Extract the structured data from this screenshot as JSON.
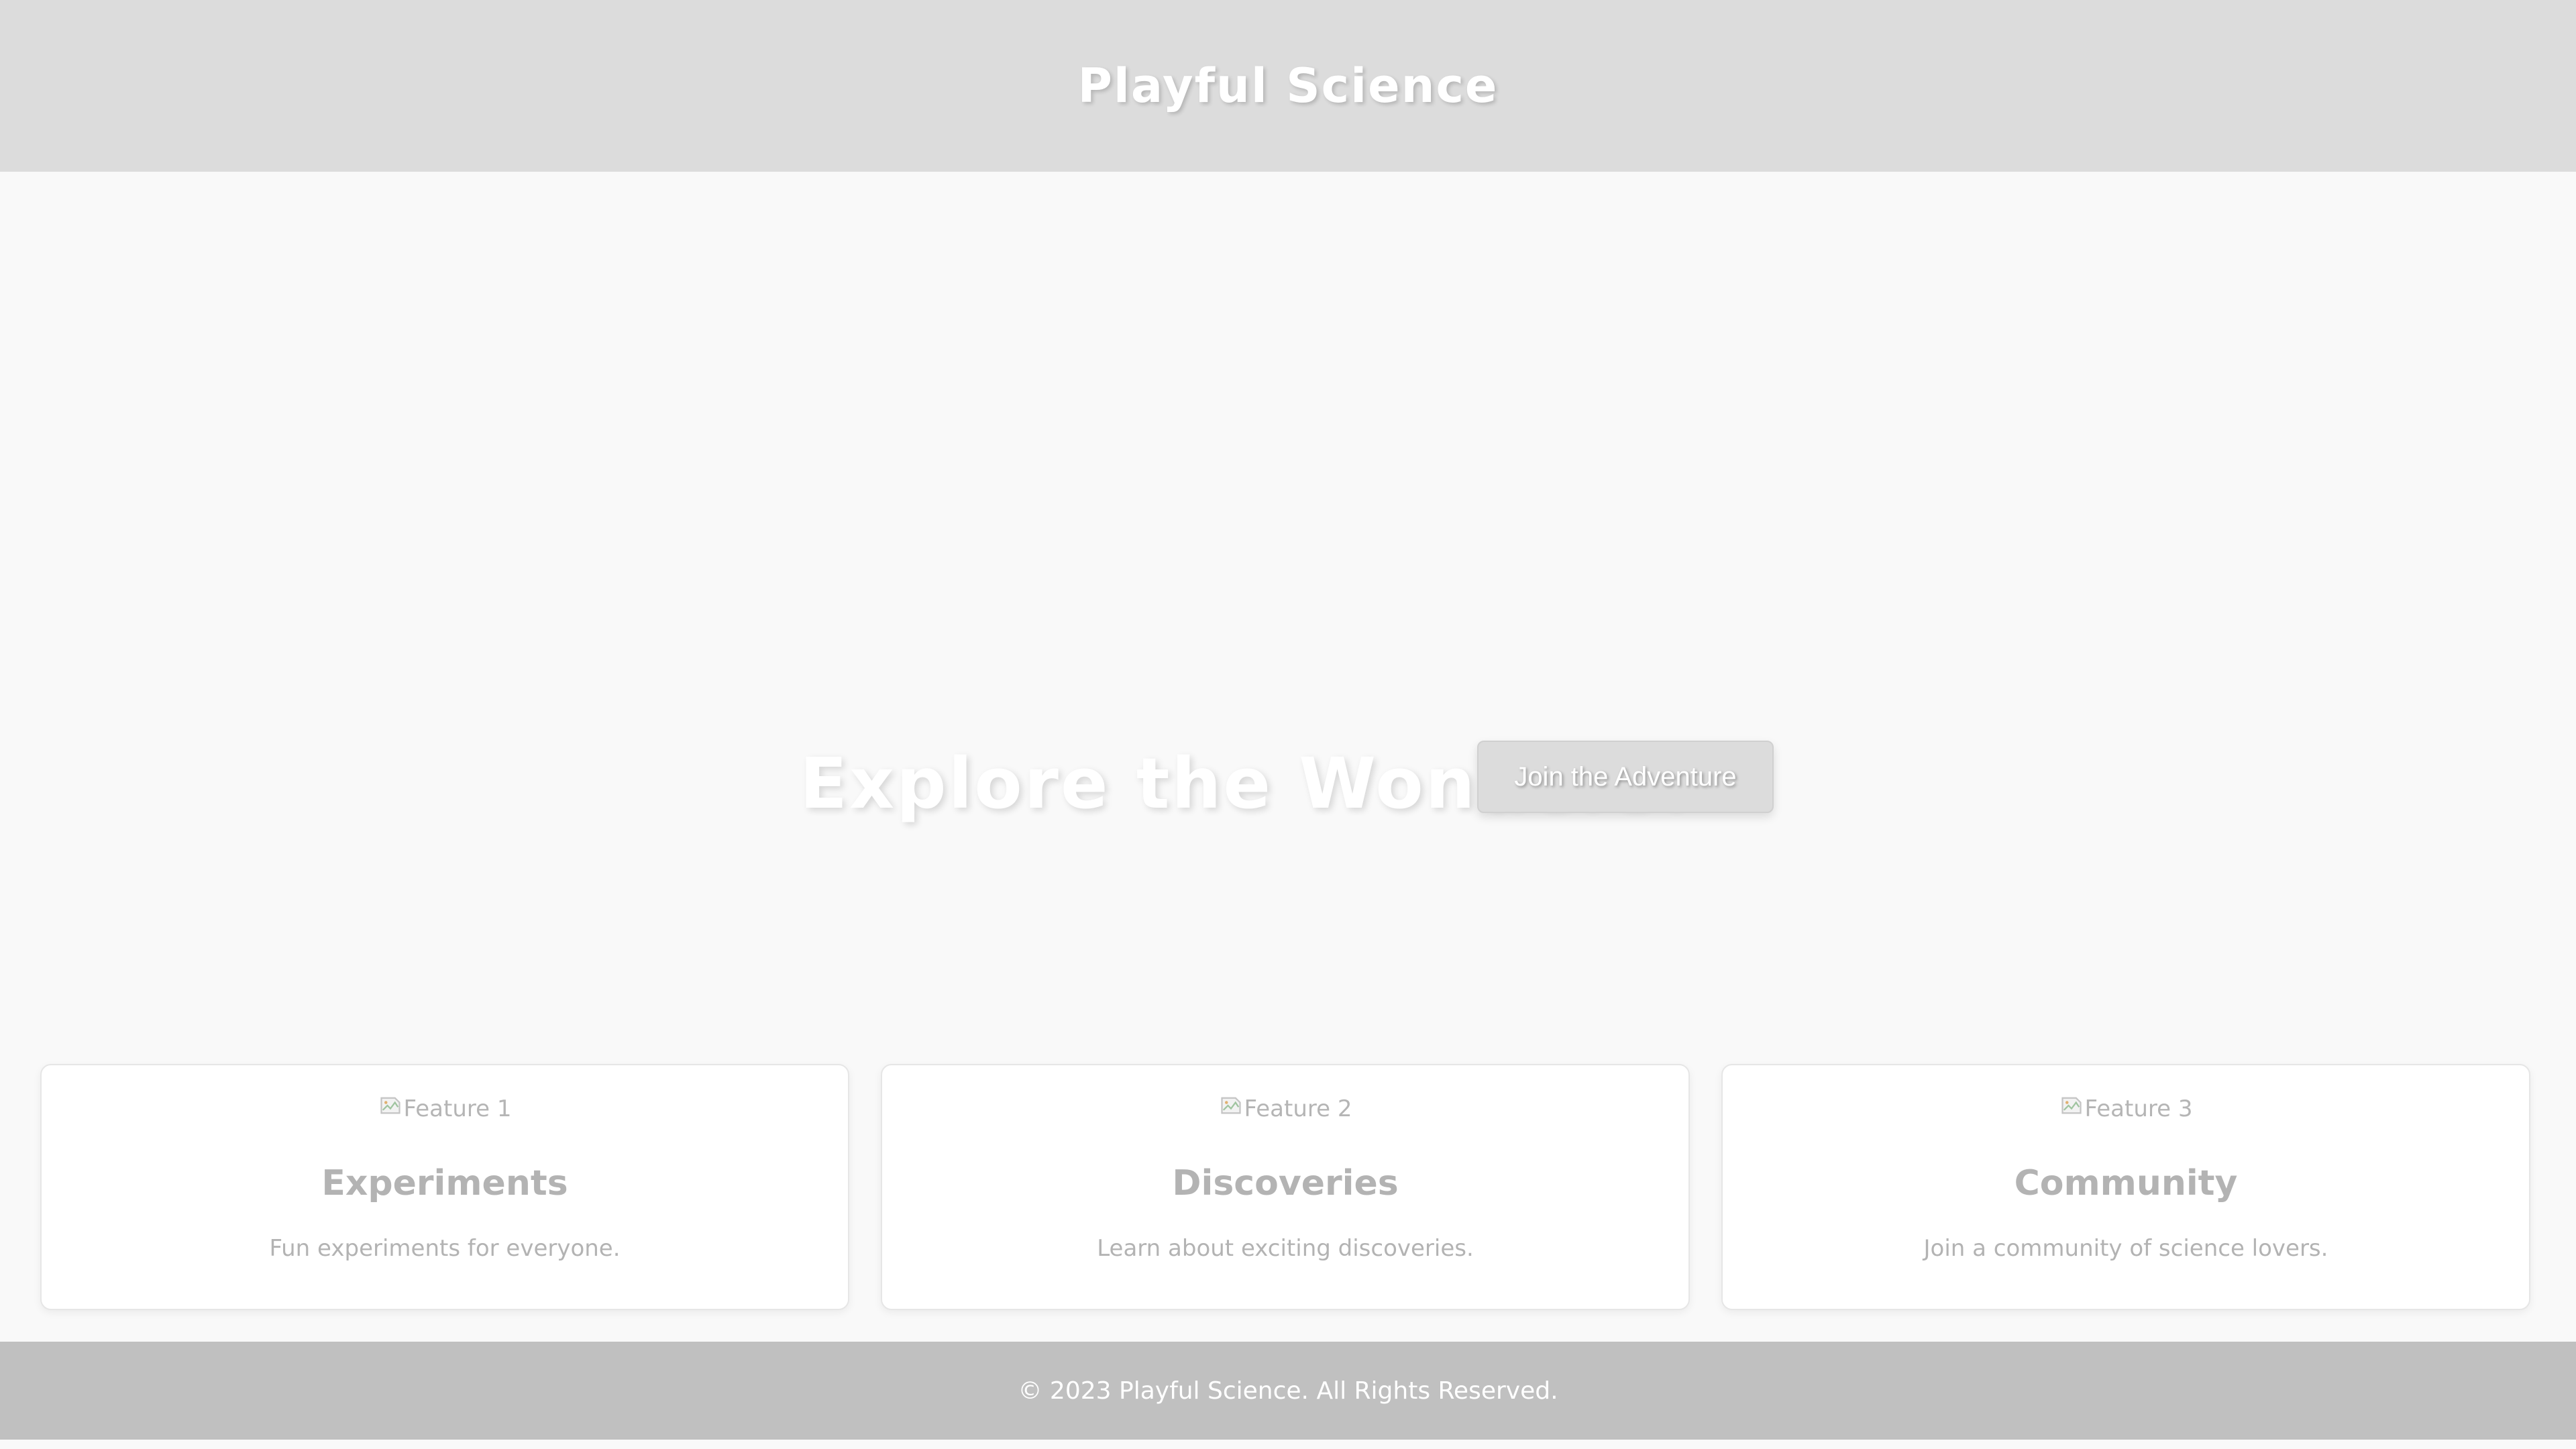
{
  "header": {
    "title": "Playful Science"
  },
  "hero": {
    "heading": "Explore the Wonders!",
    "cta_label": "Join the Adventure"
  },
  "features": [
    {
      "image_alt": "Feature 1",
      "title": "Experiments",
      "description": "Fun experiments for everyone."
    },
    {
      "image_alt": "Feature 2",
      "title": "Discoveries",
      "description": "Learn about exciting discoveries."
    },
    {
      "image_alt": "Feature 3",
      "title": "Community",
      "description": "Join a community of science lovers."
    }
  ],
  "footer": {
    "text": "© 2023 Playful Science. All Rights Reserved."
  },
  "colors": {
    "header_bg": "#dcdcdc",
    "page_bg": "#f9f9f9",
    "footer_bg": "#c0c0c0",
    "card_text": "#b3b3b3"
  },
  "icons": {
    "feature_image": "broken-image-icon"
  }
}
